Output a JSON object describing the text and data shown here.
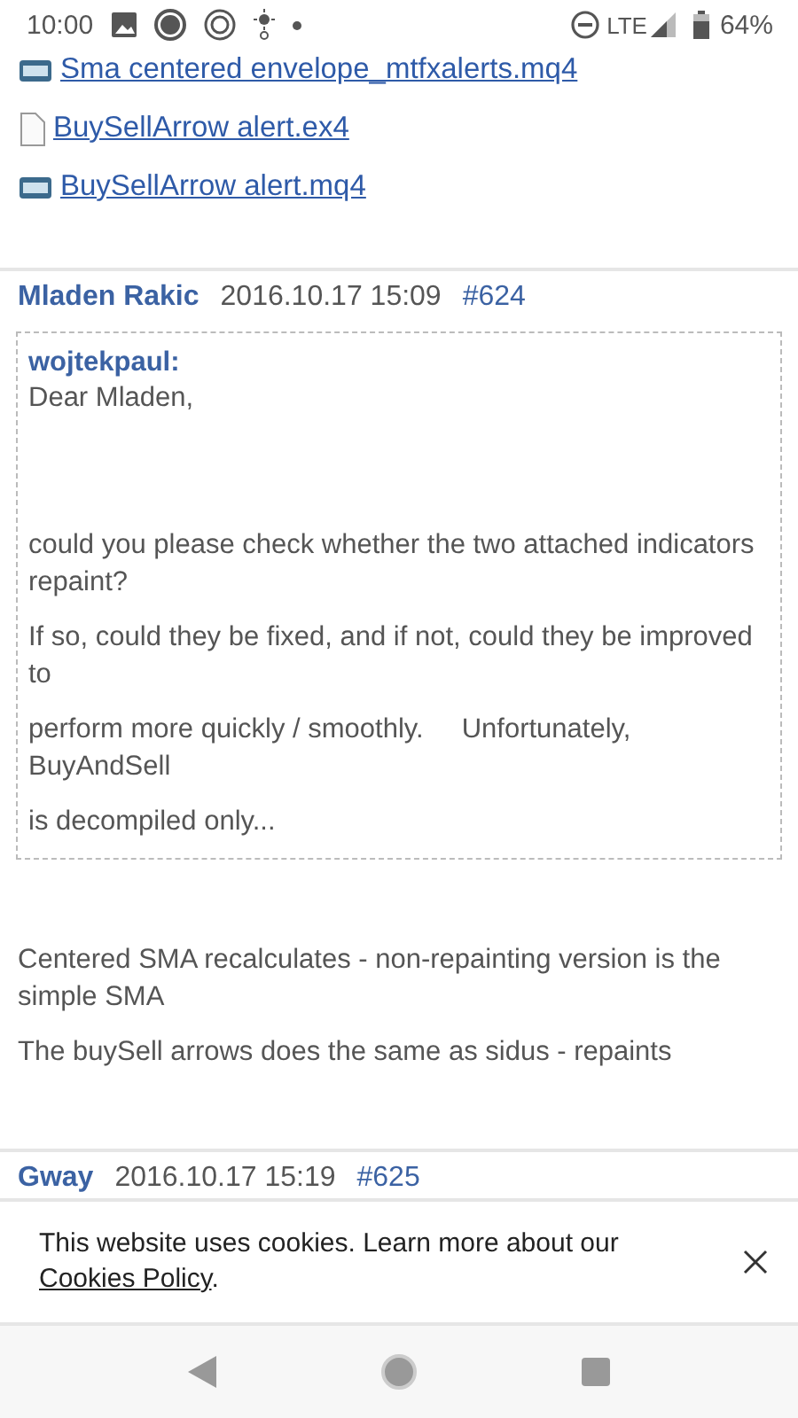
{
  "status_bar": {
    "time": "10:00",
    "network": "LTE",
    "battery": "64%"
  },
  "attachments": [
    {
      "kind": "mq4",
      "name": "Sma centered envelope_mtfxalerts.mq4"
    },
    {
      "kind": "file",
      "name": "BuySellArrow alert.ex4"
    },
    {
      "kind": "mq4",
      "name": "BuySellArrow alert.mq4"
    }
  ],
  "posts": [
    {
      "author": "Mladen Rakic",
      "date": "2016.10.17 15:09",
      "number": "#624",
      "quote": {
        "author": "wojtekpaul:",
        "greeting": "Dear Mladen,",
        "paragraphs": [
          "could you please check whether the two attached indicators repaint?",
          "If so, could they be fixed, and if not, could they be improved to",
          "perform more quickly / smoothly.     Unfortunately, BuyAndSell",
          "is decompiled only..."
        ]
      },
      "paragraphs": [
        "Centered SMA recalculates - non-repainting version is the simple SMA",
        "The buySell arrows does the same as sidus - repaints"
      ]
    },
    {
      "author": "Gway",
      "date": "2016.10.17 15:19",
      "number": "#625"
    }
  ],
  "cookie_banner": {
    "text": "This website uses cookies. Learn more about our",
    "link": "Cookies Policy",
    "end": "."
  }
}
